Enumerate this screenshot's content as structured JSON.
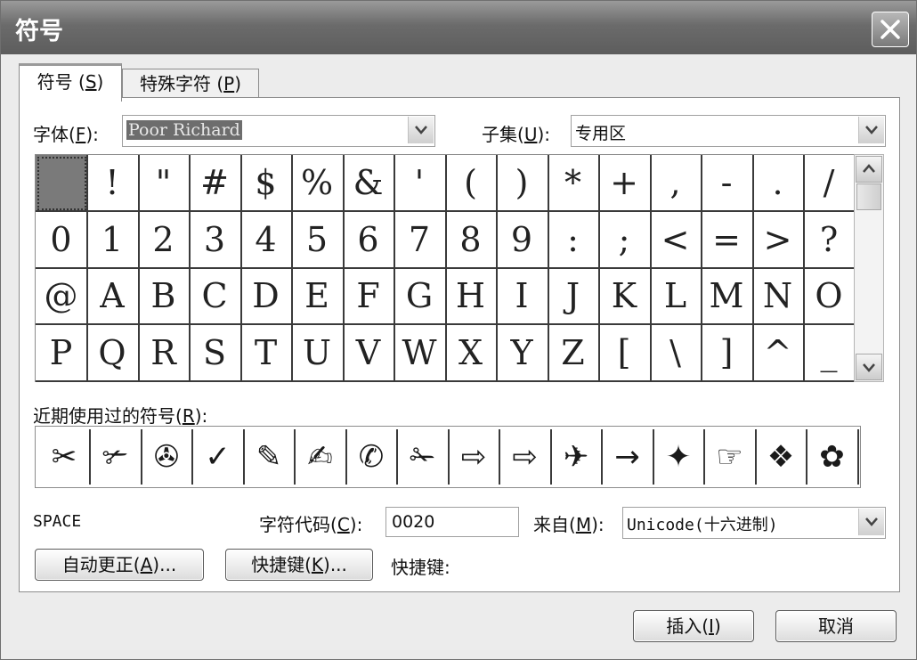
{
  "window": {
    "title": "符号"
  },
  "tabs": [
    {
      "label": "符号",
      "key": "S"
    },
    {
      "label": "特殊字符",
      "key": "P"
    }
  ],
  "font": {
    "label": "字体",
    "key": "F",
    "value": "Poor Richard"
  },
  "subset": {
    "label": "子集",
    "key": "U",
    "value": "专用区"
  },
  "symbols": [
    " ",
    "!",
    "\"",
    "#",
    "$",
    "%",
    "&",
    "'",
    "(",
    ")",
    "*",
    "+",
    ",",
    "-",
    ".",
    "/",
    "0",
    "1",
    "2",
    "3",
    "4",
    "5",
    "6",
    "7",
    "8",
    "9",
    ":",
    ";",
    "<",
    "=",
    ">",
    "?",
    "@",
    "A",
    "B",
    "C",
    "D",
    "E",
    "F",
    "G",
    "H",
    "I",
    "J",
    "K",
    "L",
    "M",
    "N",
    "O",
    "P",
    "Q",
    "R",
    "S",
    "T",
    "U",
    "V",
    "W",
    "X",
    "Y",
    "Z",
    "[",
    "\\",
    "]",
    "^",
    "_"
  ],
  "recent": {
    "label": "近期使用过的符号",
    "key": "R",
    "items": [
      "✂",
      "✃",
      "✇",
      "✓",
      "✎",
      "✍",
      "✆",
      "✁",
      "⇨",
      "⇨",
      "✈",
      "→",
      "✦",
      "☞",
      "❖",
      "✿"
    ]
  },
  "char_name": "SPACE",
  "char_code": {
    "label": "字符代码",
    "key": "C",
    "value": "0020"
  },
  "from": {
    "label": "来自",
    "key": "M",
    "value": "Unicode(十六进制)"
  },
  "buttons": {
    "autocorrect": "自动更正",
    "autocorrect_key": "A",
    "shortcut": "快捷键",
    "shortcut_key": "K",
    "ellipsis": "...",
    "shortcut_label": "快捷键:",
    "insert": "插入",
    "insert_key": "I",
    "cancel": "取消"
  }
}
